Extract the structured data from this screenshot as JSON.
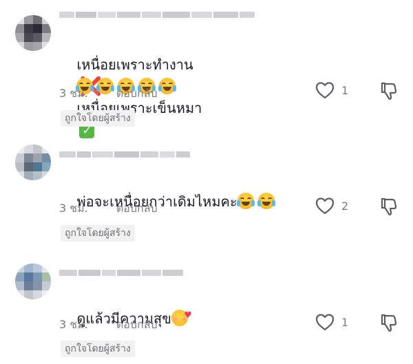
{
  "comments": [
    {
      "text_part1": "เหนื่อยเพราะทำงาน",
      "cross": "❌",
      "text_part2": "เหนื่อยเพราะเข็นหมา",
      "check": "✓",
      "emoji_row": [
        "face-with-tears-of-joy",
        "face-with-tears-of-joy",
        "face-with-tears-of-joy",
        "face-with-tears-of-joy",
        "face-with-tears-of-joy"
      ],
      "time": "3 ชม.",
      "reply": "ตอบกลับ",
      "likes": "1",
      "badge": "ถูกใจโดยผู้สร้าง"
    },
    {
      "text": "พ่อจะเหนื่อยกว่าเดิมไหมคะ",
      "emojis": [
        "face-with-tears-of-joy",
        "face-with-tears-of-joy"
      ],
      "time": "3 ชม.",
      "reply": "ตอบกลับ",
      "likes": "2",
      "badge": "ถูกใจโดยผู้สร้าง"
    },
    {
      "text": "ดูแล้วมีความสุข",
      "emojis": [
        "smiling-face-with-hearts"
      ],
      "time": "3 ชม.",
      "reply": "ตอบกลับ",
      "likes": "1",
      "badge": "ถูกใจโดยผู้สร้าง"
    }
  ],
  "icons": {
    "like": "heart-outline-icon",
    "dislike": "thumbs-down-outline-icon"
  },
  "colors": {
    "text": "#161823",
    "meta": "#7a7b81",
    "badge_bg": "#f1f1f2"
  }
}
